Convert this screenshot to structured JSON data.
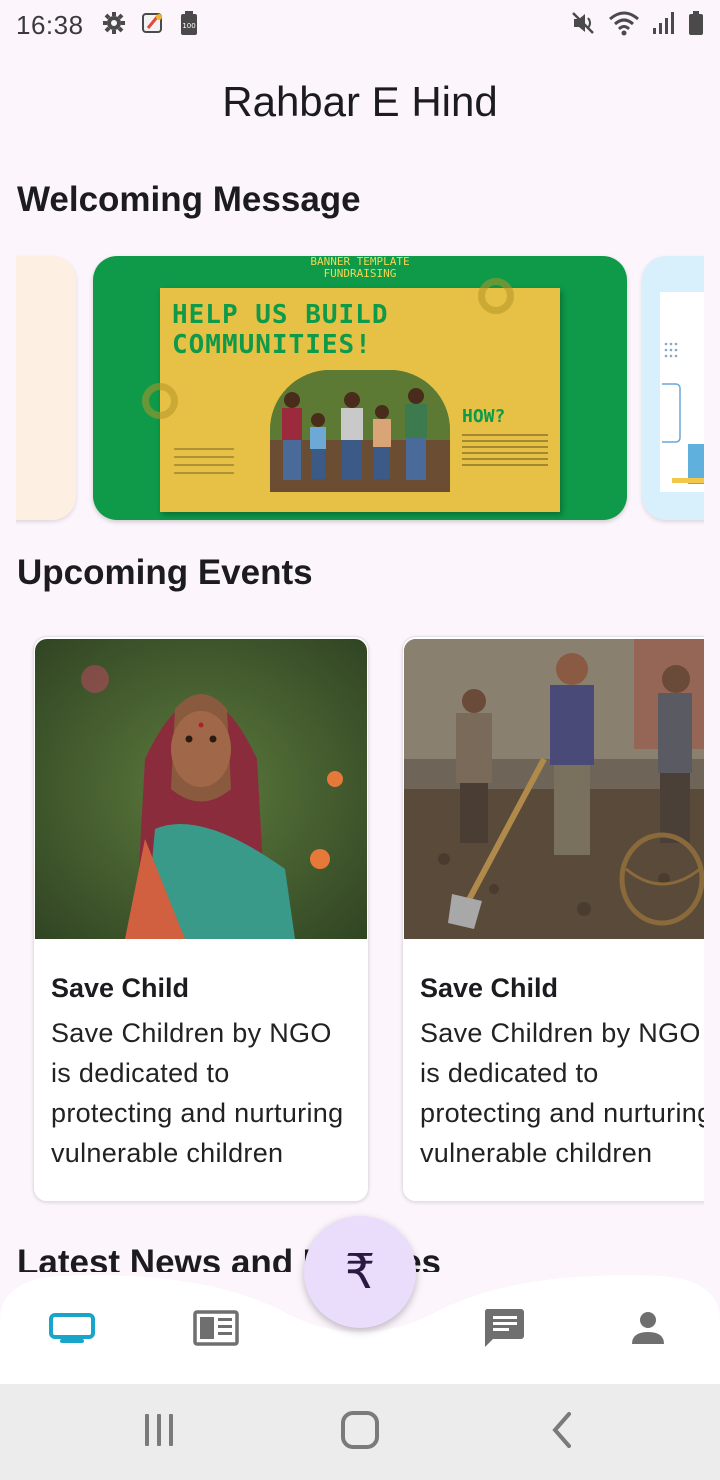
{
  "status_bar": {
    "time": "16:38",
    "left_icons": [
      "gear-icon",
      "app-notification-icon",
      "battery-saver-icon"
    ],
    "right_icons": [
      "mute-icon",
      "wifi-icon",
      "signal-icon",
      "battery-icon"
    ],
    "battery_badge": "100"
  },
  "app": {
    "title": "Rahbar E Hind"
  },
  "sections": {
    "welcome": "Welcoming Message",
    "events": "Upcoming Events",
    "news": "Latest News and Updates"
  },
  "banner": {
    "top_label": "BANNER TEMPLATE\nFUNDRAISING",
    "headline": "HELP US BUILD COMMUNITIES!",
    "how": "HOW?",
    "colors": {
      "green": "#0f9a4a",
      "yellow": "#e6c146"
    }
  },
  "events": [
    {
      "title": "Save Child",
      "description": "Save Children by NGO is dedicated to protecting and nurturing vulnerable children"
    },
    {
      "title": "Save Child",
      "description": "Save Children by NGO is dedicated to protecting and nurturing vulnerable children"
    }
  ],
  "bottom_nav": {
    "items": [
      "tv-icon",
      "news-icon",
      "chat-icon",
      "person-icon"
    ],
    "fab_symbol": "₹",
    "active_color": "#18a5c9",
    "inactive_color": "#6f6f6f"
  },
  "system_nav": [
    "recents-icon",
    "home-icon",
    "back-icon"
  ]
}
